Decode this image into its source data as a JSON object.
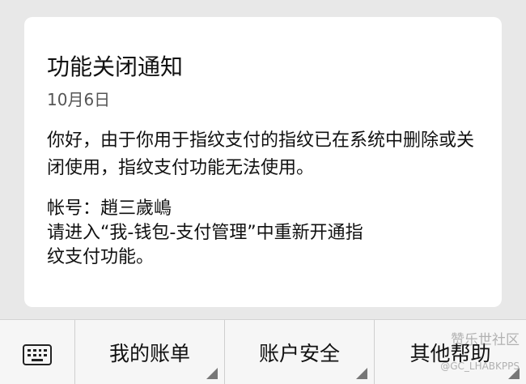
{
  "message": {
    "title": "功能关闭通知",
    "date": "10月6日",
    "paragraph1": "你好，由于你用于指纹支付的指纹已在系统中删除或关闭使用，指纹支付功能无法使用。",
    "account_line": "帐号：趙三歲嶋",
    "instruction_line1": "请进入“我-钱包-支付管理”中重新开通指",
    "instruction_line2": "纹支付功能。"
  },
  "menu": {
    "keyboard_icon": "keyboard-icon",
    "items": [
      {
        "label": "我的账单"
      },
      {
        "label": "账户安全"
      },
      {
        "label": "其他帮助"
      }
    ]
  },
  "watermark": {
    "top": "赞乐世社区",
    "bottom": "@GC_LHABKPPS"
  }
}
